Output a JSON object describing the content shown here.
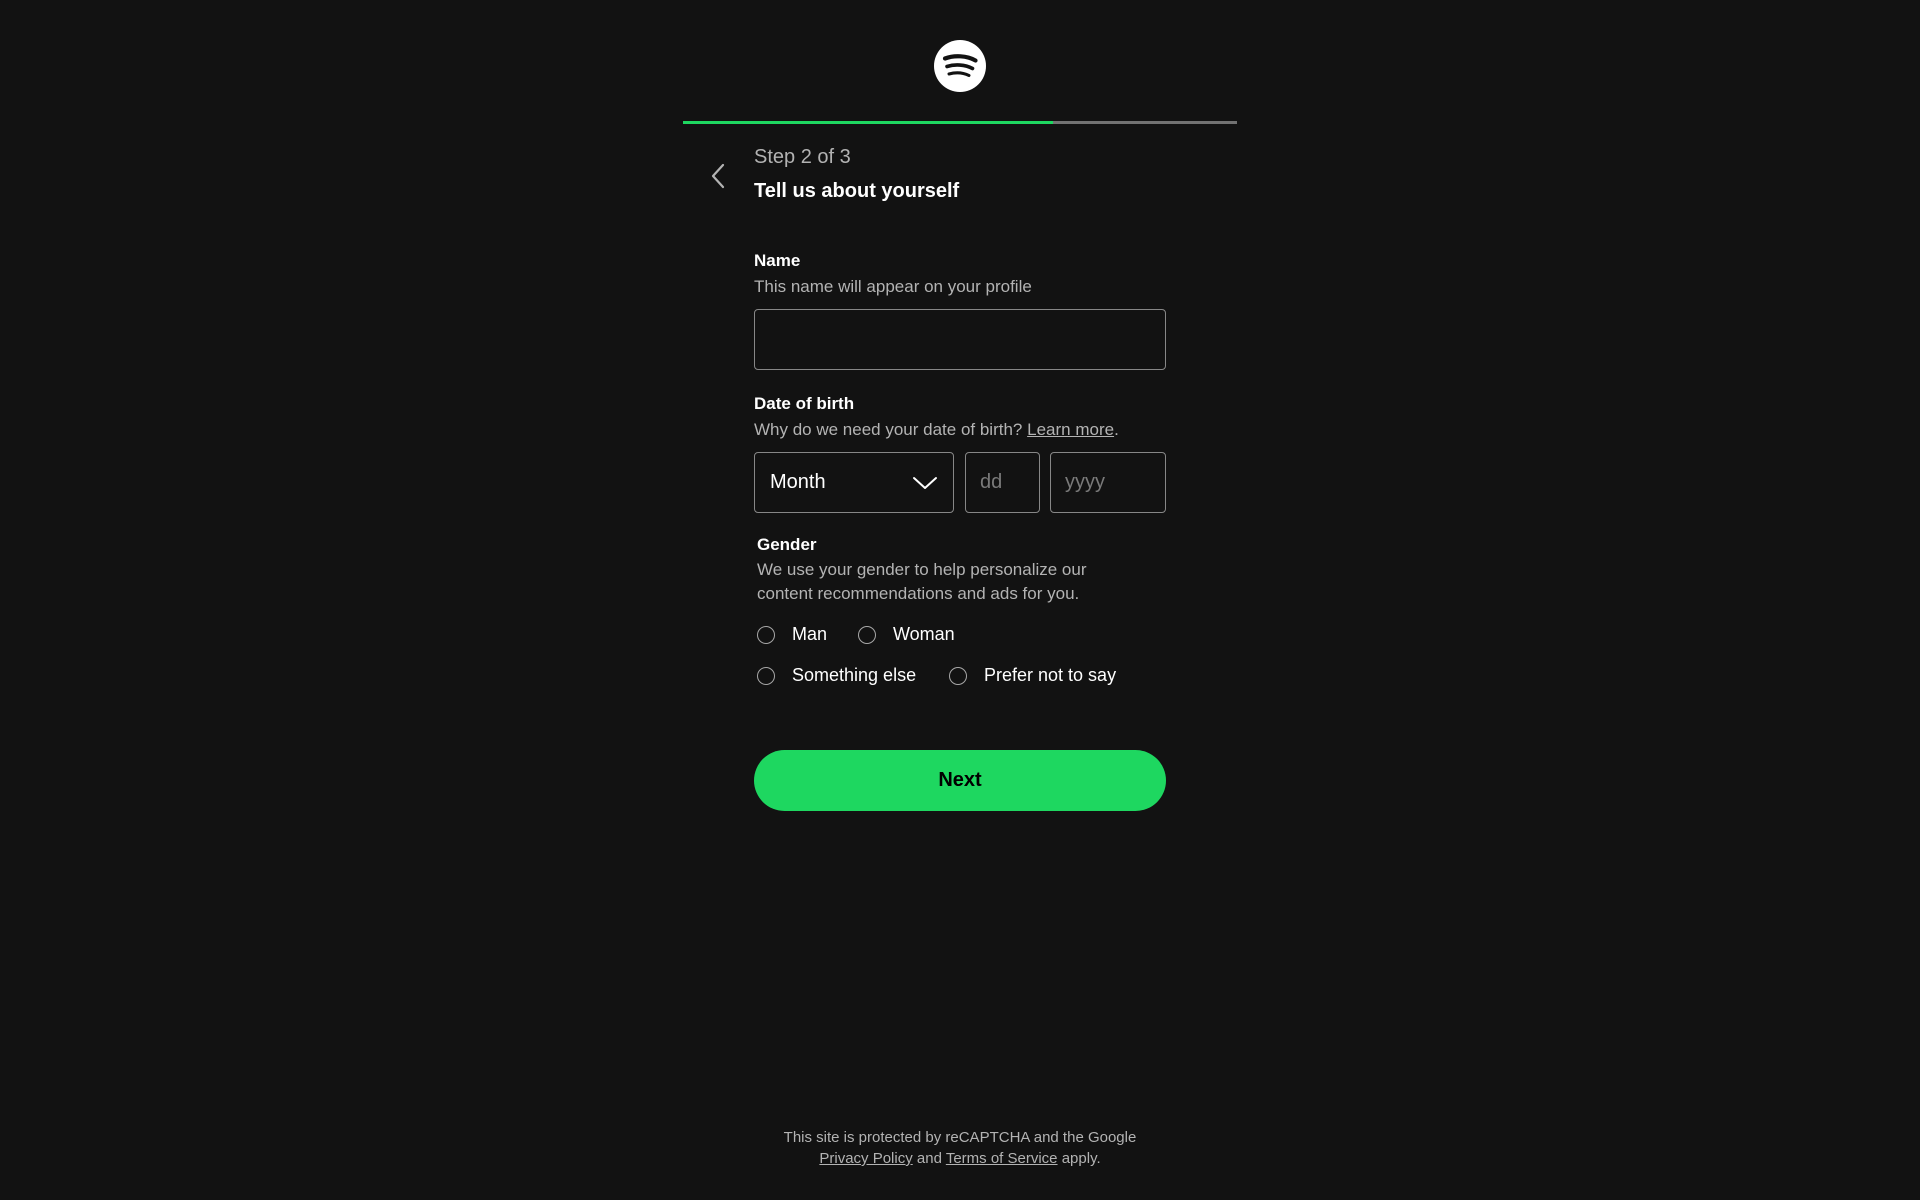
{
  "brand": {
    "logo_icon": "spotify-logo-icon",
    "accent_color": "#1ed760"
  },
  "progress": {
    "current_step": 2,
    "total_steps": 3,
    "fraction": 0.667
  },
  "header": {
    "back_icon": "chevron-left-icon",
    "step_label": "Step 2 of 3",
    "title": "Tell us about yourself"
  },
  "name_field": {
    "label": "Name",
    "help": "This name will appear on your profile",
    "value": "",
    "placeholder": ""
  },
  "dob_field": {
    "label": "Date of birth",
    "help": "Why do we need your date of birth?",
    "learn_more": "Learn more",
    "help_suffix": ".",
    "month_value": "Month",
    "month_icon": "chevron-down-icon",
    "day_placeholder": "dd",
    "year_placeholder": "yyyy"
  },
  "gender_field": {
    "label": "Gender",
    "help_line1": "We use your gender to help personalize our",
    "help_line2": "content recommendations and ads for you.",
    "options": [
      "Man",
      "Woman",
      "Something else",
      "Prefer not to say"
    ]
  },
  "next_button": {
    "label": "Next"
  },
  "footer": {
    "line1": "This site is protected by reCAPTCHA and the Google",
    "privacy_policy": "Privacy Policy",
    "and": "and",
    "terms": "Terms of Service",
    "apply": "apply."
  }
}
